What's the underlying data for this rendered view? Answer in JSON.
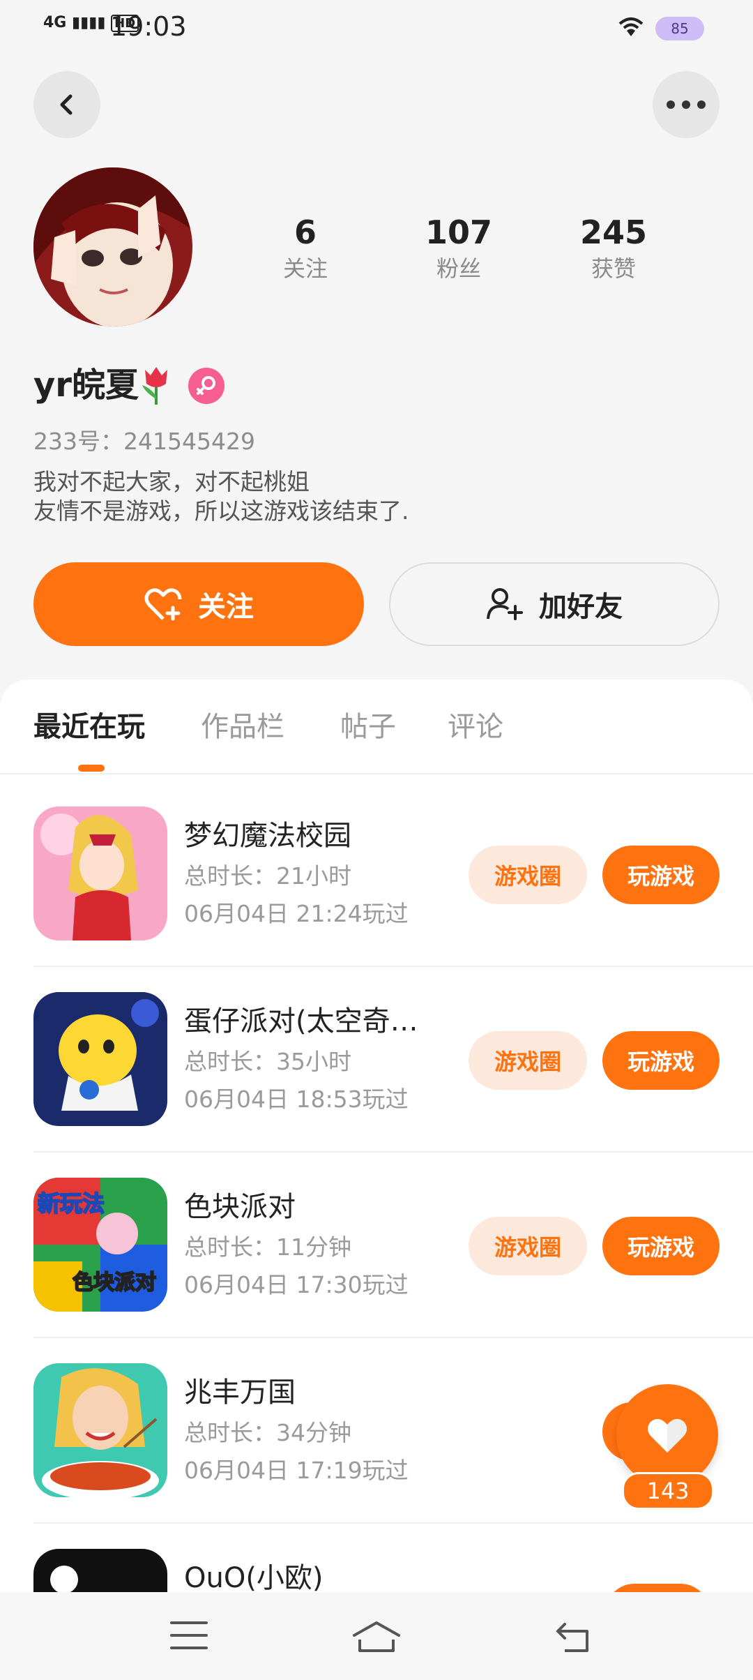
{
  "status_bar": {
    "network": "4G",
    "hd": "HD",
    "time": "19:03",
    "battery": "85"
  },
  "profile": {
    "username": "yr皖夏",
    "uid_label": "233号：",
    "uid": "241545429",
    "bio_line1": "我对不起大家，对不起桃姐",
    "bio_line2": "友情不是游戏，所以这游戏该结束了.",
    "gender": "female"
  },
  "stats": [
    {
      "value": "6",
      "label": "关注"
    },
    {
      "value": "107",
      "label": "粉丝"
    },
    {
      "value": "245",
      "label": "获赞"
    }
  ],
  "actions": {
    "follow_label": "关注",
    "add_friend_label": "加好友"
  },
  "tabs": [
    {
      "label": "最近在玩",
      "active": true
    },
    {
      "label": "作品栏",
      "active": false
    },
    {
      "label": "帖子",
      "active": false
    },
    {
      "label": "评论",
      "active": false
    }
  ],
  "games": [
    {
      "name": "梦幻魔法校园",
      "duration_label": "总时长：",
      "duration": "21小时",
      "last_played": "06月04日 21:24玩过",
      "circle_label": "游戏圈",
      "play_label": "玩游戏"
    },
    {
      "name": "蛋仔派对(太空奇…",
      "duration_label": "总时长：",
      "duration": "35小时",
      "last_played": "06月04日 18:53玩过",
      "circle_label": "游戏圈",
      "play_label": "玩游戏"
    },
    {
      "name": "色块派对",
      "duration_label": "总时长：",
      "duration": "11分钟",
      "last_played": "06月04日 17:30玩过",
      "circle_label": "游戏圈",
      "play_label": "玩游戏"
    },
    {
      "name": "兆丰万国",
      "duration_label": "总时长：",
      "duration": "34分钟",
      "last_played": "06月04日 17:19玩过",
      "circle_label": "",
      "play_label": ""
    },
    {
      "name": "OuO(小欧)",
      "duration_label": "",
      "duration": "",
      "last_played": "",
      "circle_label": "",
      "play_label": ""
    }
  ],
  "game3_icon_text": {
    "top": "新玩法",
    "bottom": "色块派对"
  },
  "like": {
    "count": "143"
  },
  "colors": {
    "accent": "#ff7210",
    "accent_light": "#fde9dc",
    "background": "#f5f5f5"
  }
}
